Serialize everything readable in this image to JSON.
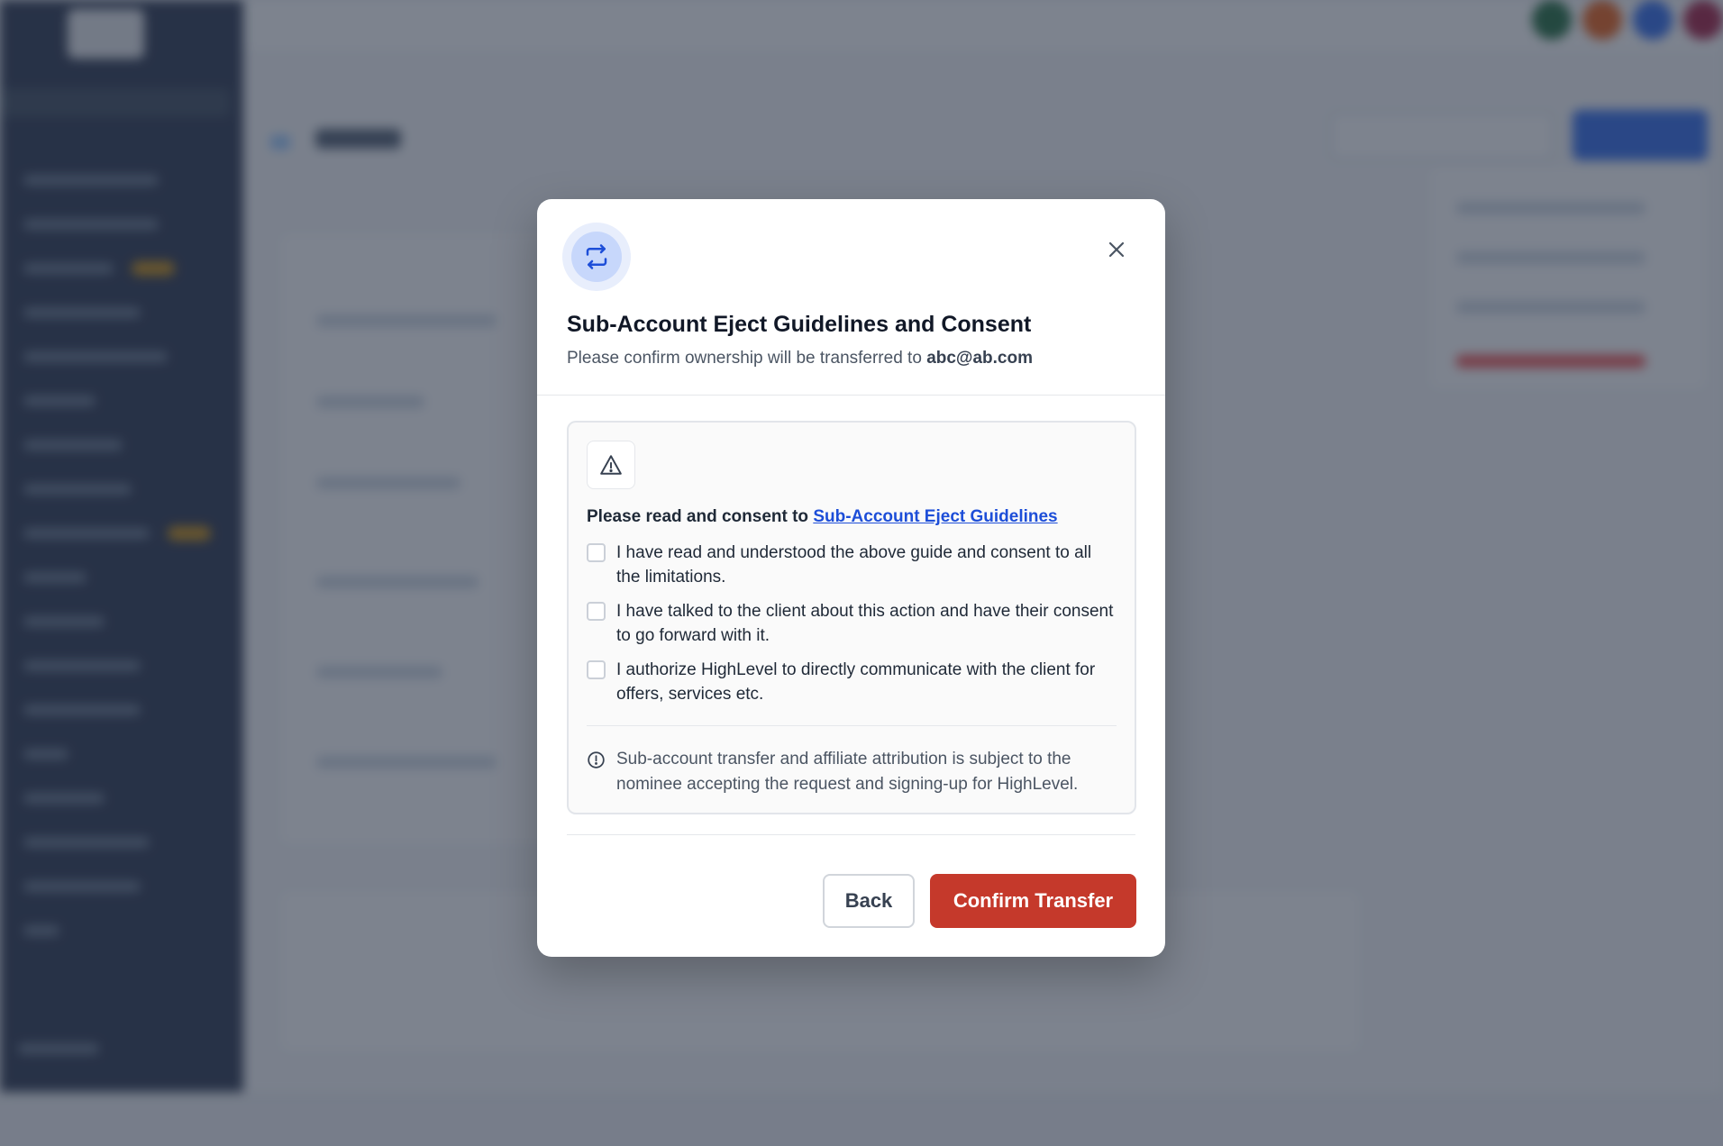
{
  "modal": {
    "title": "Sub-Account Eject Guidelines and Consent",
    "subtitle_prefix": "Please confirm ownership will be transferred to ",
    "email": "abc@ab.com",
    "header_icon": "transfer-arrows-icon",
    "close_icon": "close-icon",
    "consent": {
      "warning_icon": "warning-triangle-icon",
      "heading_prefix": "Please read and consent to ",
      "guidelines_link": "Sub-Account Eject Guidelines",
      "checkboxes": [
        {
          "label": "I have read and understood the above guide and consent to all the limitations.",
          "checked": false
        },
        {
          "label": "I have talked to the client about this action and have their consent to go forward with it.",
          "checked": false
        },
        {
          "label": "I authorize HighLevel to directly communicate with the client for offers, services etc.",
          "checked": false
        }
      ],
      "info_icon": "info-circle-icon",
      "info_text": "Sub-account transfer and affiliate attribution is subject to the nominee accepting the request and signing-up for HighLevel."
    },
    "buttons": {
      "back": "Back",
      "confirm": "Confirm Transfer"
    }
  },
  "colors": {
    "primary_link": "#1d4ed8",
    "danger": "#c5392b",
    "overlay": "rgba(45, 55, 72, 0.62)"
  }
}
